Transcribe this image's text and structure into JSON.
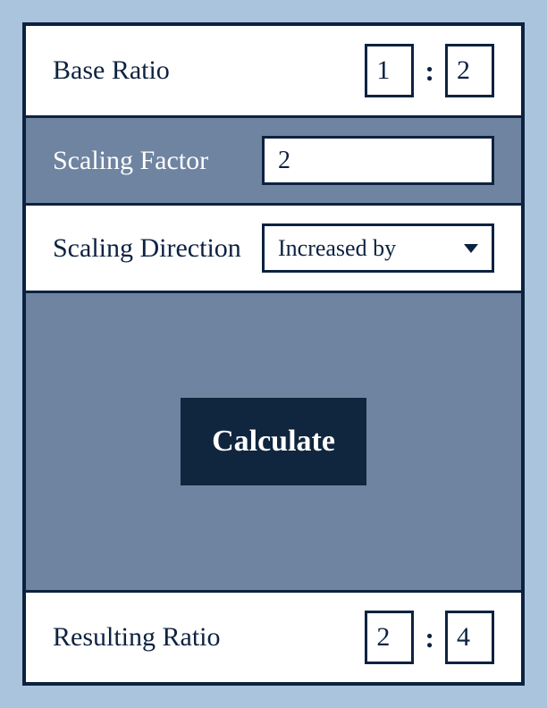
{
  "baseRatio": {
    "label": "Base Ratio",
    "value1": "1",
    "value2": "2",
    "separator": ":"
  },
  "scalingFactor": {
    "label": "Scaling Factor",
    "value": "2"
  },
  "scalingDirection": {
    "label": "Scaling Direction",
    "selected": "Increased by"
  },
  "calculate": {
    "label": "Calculate"
  },
  "resultingRatio": {
    "label": "Resulting Ratio",
    "value1": "2",
    "value2": "4",
    "separator": ":"
  }
}
